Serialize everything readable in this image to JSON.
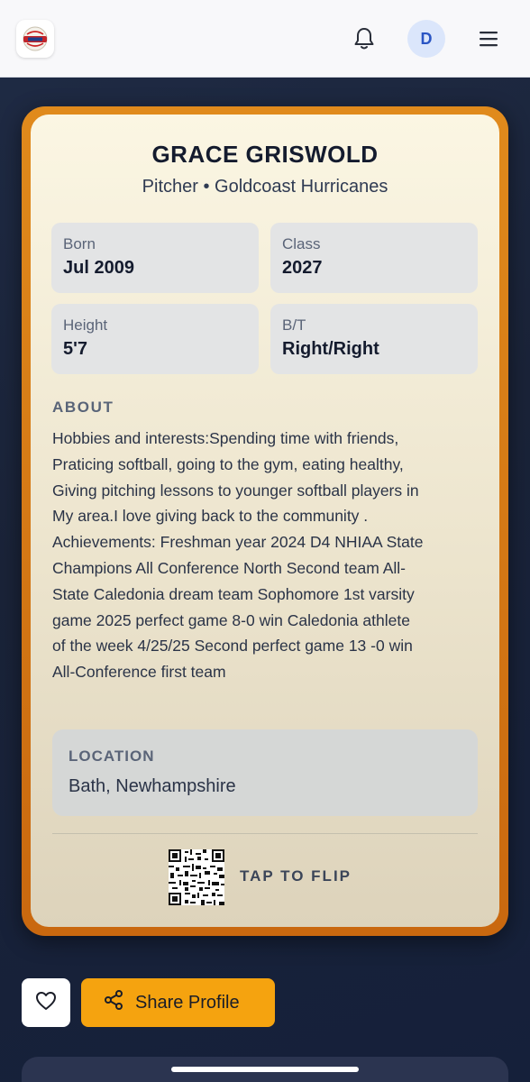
{
  "header": {
    "logo_icon": "tryout-logo-icon",
    "notifications_icon": "bell-icon",
    "avatar_initial": "D",
    "menu_icon": "hamburger-menu-icon"
  },
  "profile": {
    "name": "GRACE GRISWOLD",
    "subtitle": "Pitcher • Goldcoast Hurricanes",
    "stats": [
      {
        "label": "Born",
        "value": "Jul 2009"
      },
      {
        "label": "Class",
        "value": "2027"
      },
      {
        "label": "Height",
        "value": "5'7"
      },
      {
        "label": "B/T",
        "value": "Right/Right"
      }
    ],
    "about_heading": "ABOUT",
    "about_lines": [
      "Hobbies and interests:Spending time with friends,",
      "Praticing softball, going to the gym, eating healthy,",
      "Giving pitching lessons to younger softball players in",
      "My area.I love giving back to the community .",
      "Achievements: Freshman year 2024 D4 NHIAA State",
      "Champions All Conference North Second team All-",
      "State Caledonia dream team Sophomore 1st varsity",
      "game 2025 perfect game 8-0 win Caledonia athlete",
      "of the week 4/25/25 Second perfect game 13 -0 win",
      "All-Conference first team"
    ],
    "location_label": "LOCATION",
    "location_value": "Bath, Newhampshire",
    "flip_label": "TAP TO FLIP"
  },
  "actions": {
    "favorite_icon": "heart-icon",
    "share_icon": "share-icon",
    "share_label": "Share Profile"
  },
  "colors": {
    "card_border": "#e08a1c",
    "share_button": "#f5a30f",
    "background": "#1f2b45"
  }
}
